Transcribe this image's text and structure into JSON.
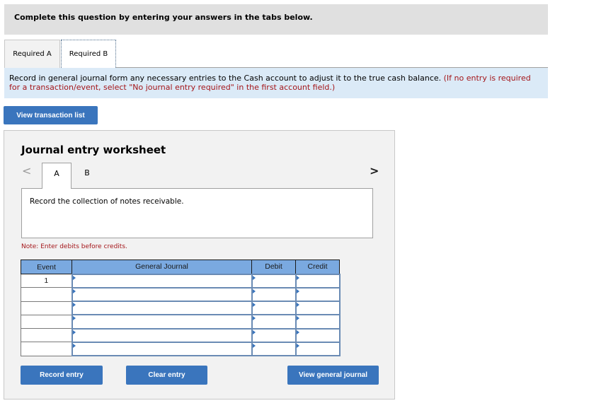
{
  "banner": {
    "text": "Complete this question by entering your answers in the tabs below."
  },
  "tabs": [
    {
      "label": "Required A",
      "active": false
    },
    {
      "label": "Required B",
      "active": true
    }
  ],
  "instructions": {
    "main": "Record in general journal form any necessary entries to the Cash account to adjust it to the true cash balance.",
    "note": "(If no entry is required for a transaction/event, select \"No journal entry required\" in the first account field.)"
  },
  "buttons": {
    "view_transaction_list": "View transaction list",
    "record_entry": "Record entry",
    "clear_entry": "Clear entry",
    "view_general_journal": "View general journal"
  },
  "worksheet": {
    "title": "Journal entry worksheet",
    "nav_prev": "<",
    "nav_next": ">",
    "subtabs": [
      {
        "label": "A",
        "active": true
      },
      {
        "label": "B",
        "active": false
      }
    ],
    "description": "Record the collection of notes receivable.",
    "note": "Note: Enter debits before credits.",
    "table": {
      "headers": {
        "event": "Event",
        "journal": "General Journal",
        "debit": "Debit",
        "credit": "Credit"
      },
      "rows": [
        {
          "event": "1",
          "account": "",
          "debit": "",
          "credit": ""
        },
        {
          "event": "",
          "account": "",
          "debit": "",
          "credit": ""
        },
        {
          "event": "",
          "account": "",
          "debit": "",
          "credit": ""
        },
        {
          "event": "",
          "account": "",
          "debit": "",
          "credit": ""
        },
        {
          "event": "",
          "account": "",
          "debit": "",
          "credit": ""
        },
        {
          "event": "",
          "account": "",
          "debit": "",
          "credit": ""
        }
      ]
    }
  },
  "colors": {
    "button": "#3a75bd",
    "header": "#7aa9e0",
    "instruction_bg": "#dbeaf7",
    "note_red": "#a4161a"
  }
}
